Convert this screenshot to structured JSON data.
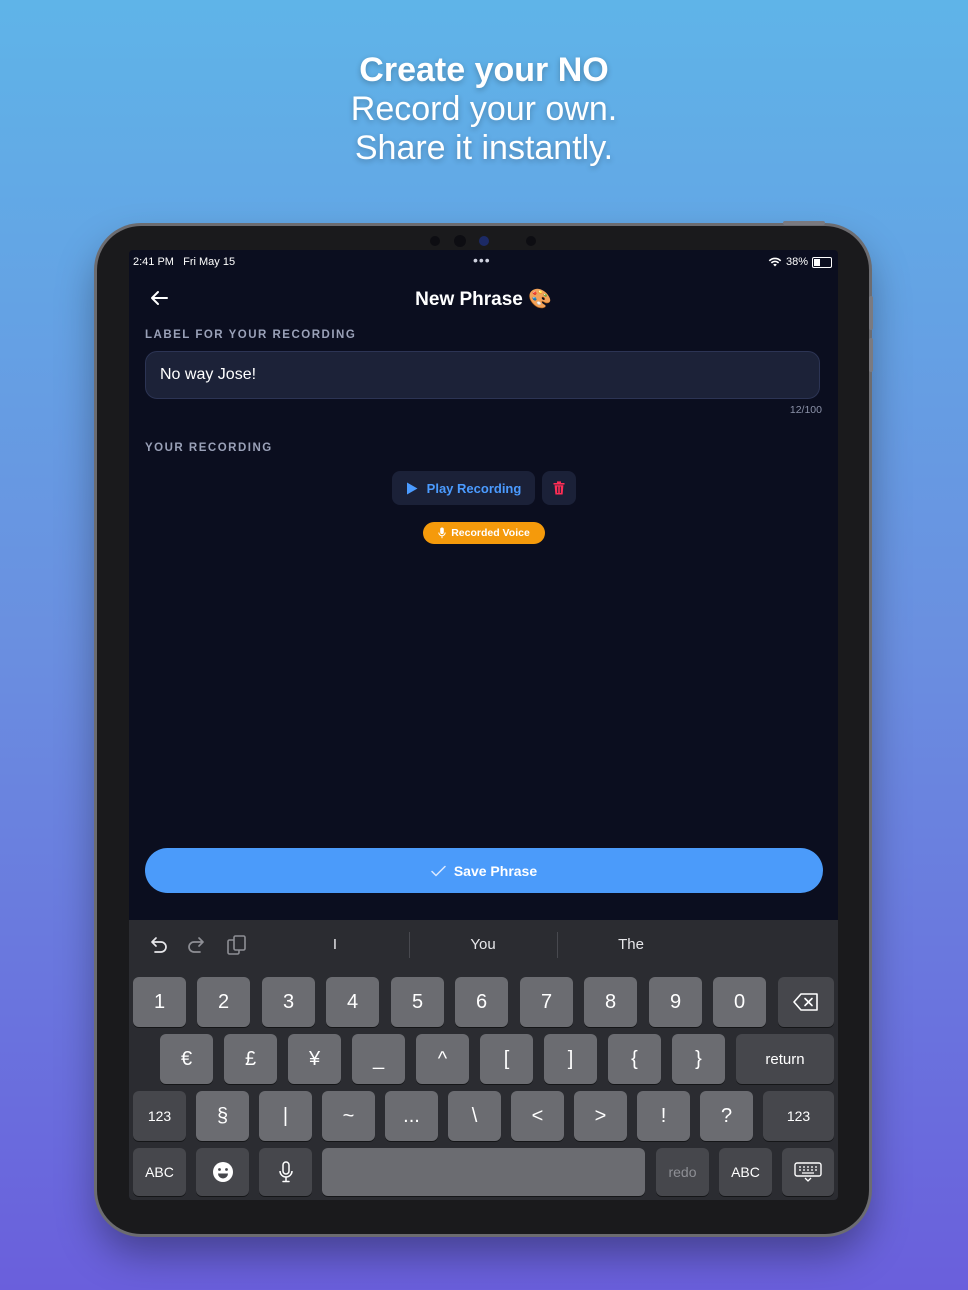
{
  "promo": {
    "line1": "Create your NO",
    "line2": "Record your own.",
    "line3": "Share it instantly."
  },
  "status_bar": {
    "time": "2:41 PM",
    "date": "Fri May 15",
    "more_dots": "•••",
    "battery": "38%"
  },
  "header": {
    "title": "New Phrase",
    "title_emoji": "🎨"
  },
  "label_section": {
    "heading": "LABEL FOR YOUR RECORDING",
    "value": "No way Jose!",
    "counter": "12/100"
  },
  "recording_section": {
    "heading": "YOUR RECORDING",
    "play_label": "Play Recording",
    "badge_label": "Recorded Voice"
  },
  "save_label": "Save Phrase",
  "colors": {
    "accent": "#4b9bfa",
    "badge": "#f59a0b",
    "delete": "#ff2d55",
    "background": "#0b0e1f"
  },
  "keyboard": {
    "suggestions": [
      "I",
      "You",
      "The"
    ],
    "rows": [
      [
        "1",
        "2",
        "3",
        "4",
        "5",
        "6",
        "7",
        "8",
        "9",
        "0"
      ],
      [
        "€",
        "£",
        "¥",
        "_",
        "^",
        "[",
        "]",
        "{",
        "}"
      ],
      [
        "§",
        "|",
        "~",
        "...",
        "\\",
        "<",
        ">",
        "!",
        "?"
      ]
    ],
    "return_label": "return",
    "mode_123": "123",
    "mode_abc": "ABC",
    "redo_label": "redo"
  }
}
